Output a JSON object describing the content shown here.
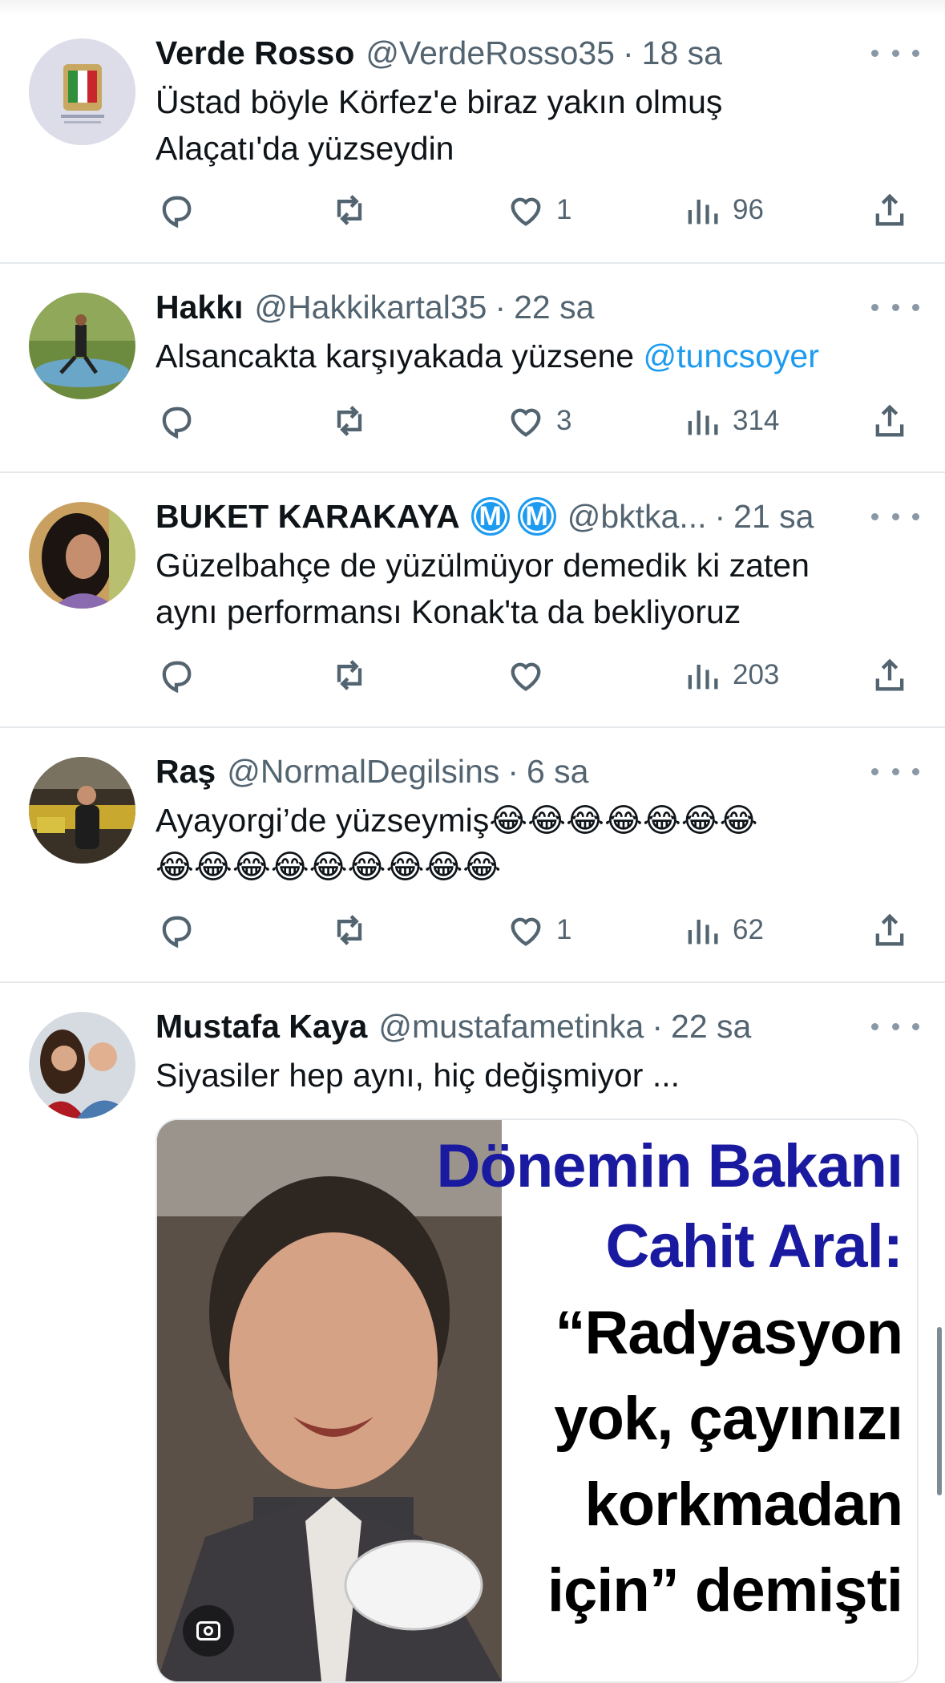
{
  "tweets": [
    {
      "name": "Verde Rosso",
      "handle": "@VerdeRosso35",
      "time": "18 sa",
      "text_lines": [
        "Üstad böyle Körfez'e biraz yakın olmuş",
        "Alaçatı'da yüzseydin"
      ],
      "replies": "",
      "retweets": "",
      "likes": "1",
      "views": "96"
    },
    {
      "name": "Hakkı",
      "handle": "@Hakkikartal35",
      "time": "22 sa",
      "text_lines": [
        "Alsancakta karşıyakada yüzsene "
      ],
      "mention": "@tuncsoyer",
      "replies": "",
      "retweets": "",
      "likes": "3",
      "views": "314"
    },
    {
      "name": "BUKET KARAKAYA",
      "badges": [
        "M",
        "M"
      ],
      "handle": "@bktka...",
      "time": "21 sa",
      "text_lines": [
        "Güzelbahçe de yüzülmüyor demedik ki zaten",
        "aynı performansı Konak'ta da bekliyoruz"
      ],
      "replies": "",
      "retweets": "",
      "likes": "",
      "views": "203"
    },
    {
      "name": "Raş",
      "handle": "@NormalDegilsins",
      "time": "6 sa",
      "text_lines": [
        "Ayayorgi’de yüzseymiş😂😂😂😂😂😂😂",
        "😂😂😂😂😂😂😂😂😂"
      ],
      "replies": "",
      "retweets": "",
      "likes": "1",
      "views": "62"
    },
    {
      "name": "Mustafa Kaya",
      "handle": "@mustafametinka",
      "time": "22 sa",
      "text_lines": [
        "Siyasiler hep aynı, hiç değişmiyor ..."
      ],
      "media": {
        "lines": [
          "Dönemin Bakanı",
          "Cahit Aral:",
          "“Radyasyon",
          "yok, çayınızı",
          "korkmadan",
          "için” demişti"
        ]
      }
    }
  ],
  "colors": {
    "text": "#0f1419",
    "secondary": "#536471",
    "accent": "#1d9bf0",
    "divider": "#e6e9ec",
    "media_heading": "#1a1aa0",
    "media_body": "#000000"
  },
  "icons": [
    "reply-icon",
    "retweet-icon",
    "like-icon",
    "views-icon",
    "share-icon",
    "more-icon",
    "alt-text-icon"
  ]
}
